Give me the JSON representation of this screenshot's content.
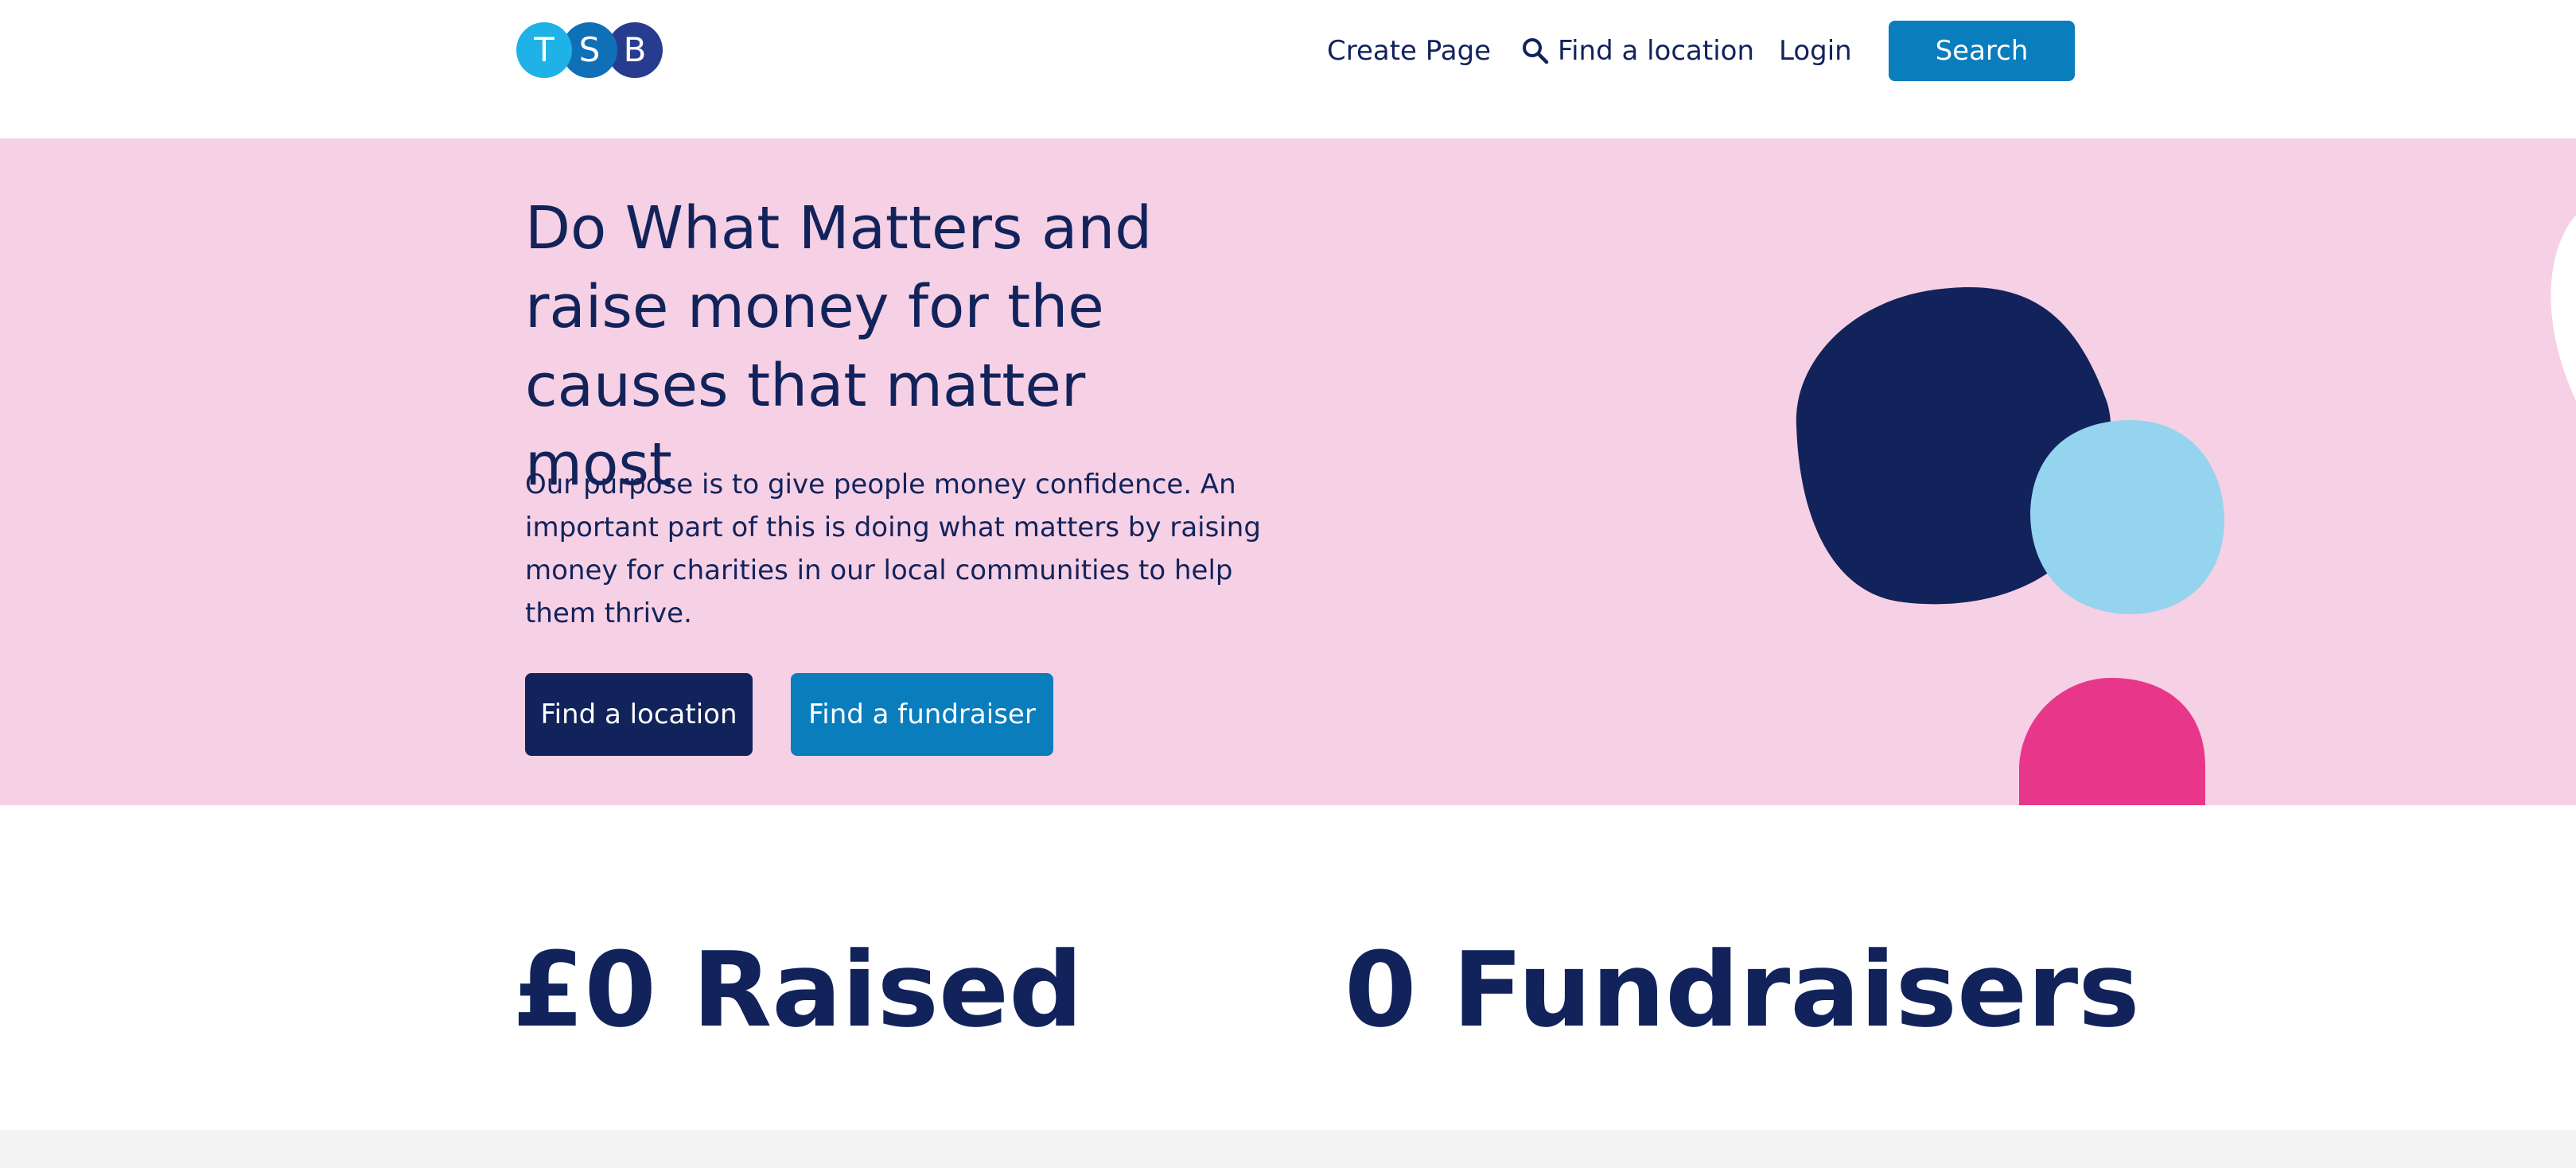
{
  "header": {
    "logo_letters": [
      "T",
      "S",
      "B"
    ],
    "nav": {
      "create_page": "Create Page",
      "find_location": "Find a location",
      "login": "Login"
    },
    "search_button": "Search"
  },
  "hero": {
    "title": "Do What Matters and raise money for the causes that matter most",
    "body": "Our purpose is to give people money confidence. An important part of this is doing what matters by raising money for charities in our local communities to help them thrive.",
    "buttons": {
      "find_location": "Find a location",
      "find_fundraiser": "Find a fundraiser"
    }
  },
  "stats": {
    "raised": "£0 Raised",
    "fundraisers": "0 Fundraisers"
  },
  "colors": {
    "navy": "#12235b",
    "blue": "#0a7dbd",
    "hero_bg": "#f6d0e4",
    "light_blue_blob": "#95d4ee",
    "pink_blob": "#e8378a"
  },
  "icons": [
    "search-icon"
  ]
}
